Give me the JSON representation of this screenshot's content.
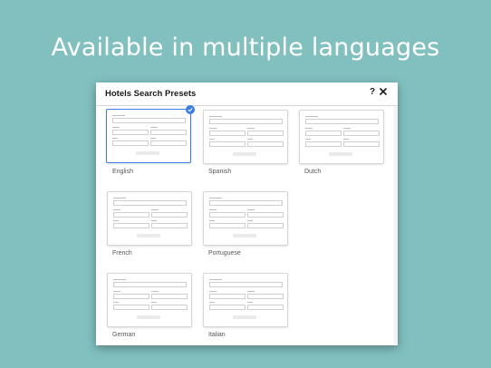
{
  "headline": "Available in multiple languages",
  "dialog": {
    "title": "Hotels Search Presets",
    "help_icon": "question-mark-icon",
    "help_glyph": "?",
    "close_icon": "close-icon"
  },
  "accent_color": "#3a7de8",
  "background_color": "#82c0c0",
  "presets": [
    {
      "label": "English",
      "selected": true
    },
    {
      "label": "Spanish",
      "selected": false
    },
    {
      "label": "Dutch",
      "selected": false
    },
    {
      "label": "French",
      "selected": false
    },
    {
      "label": "Portuguese",
      "selected": false
    },
    {
      "label": "German",
      "selected": false
    },
    {
      "label": "Italian",
      "selected": false
    }
  ]
}
